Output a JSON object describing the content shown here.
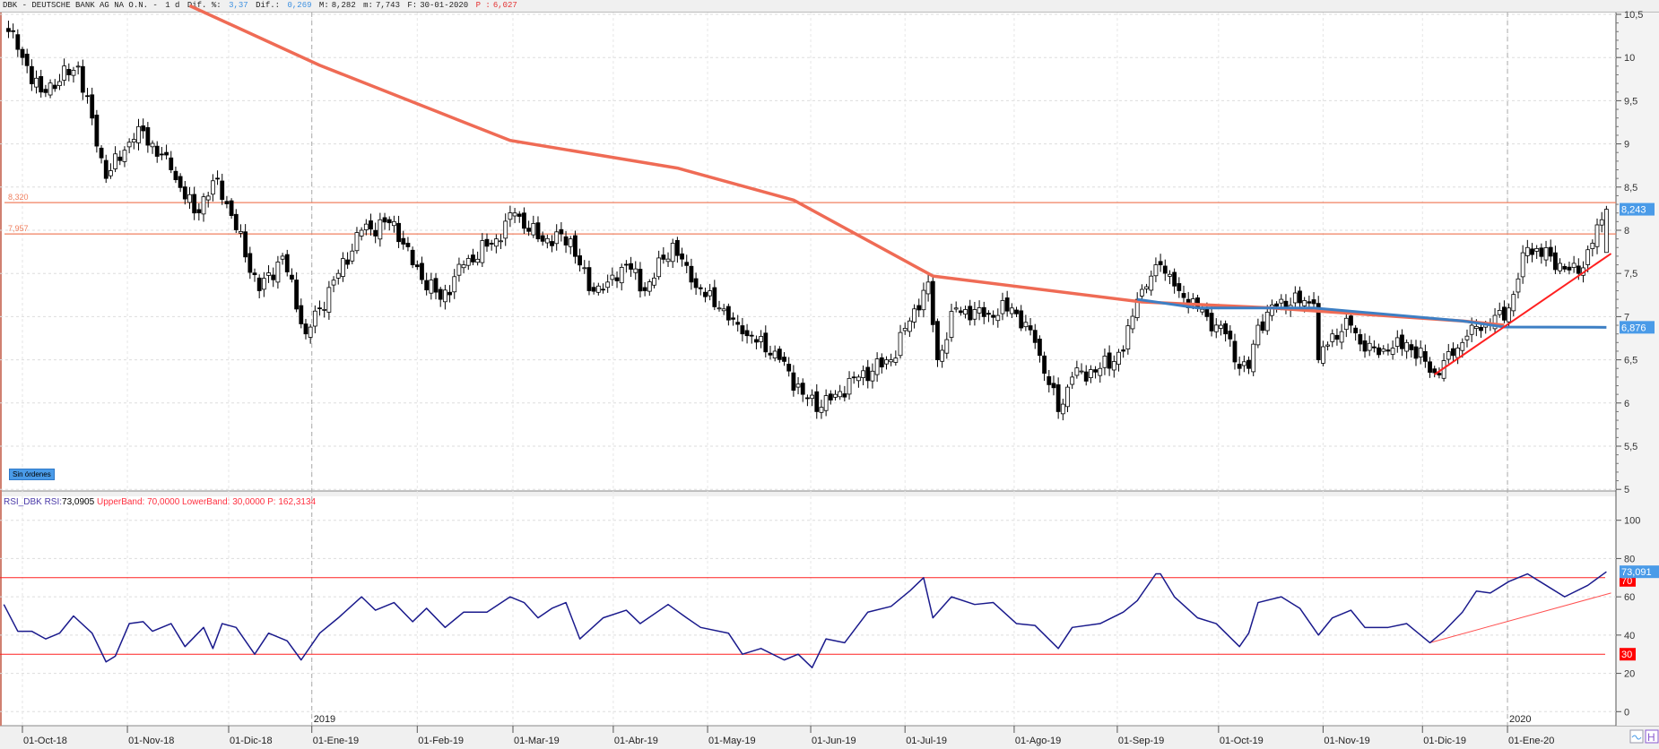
{
  "header": {
    "symbol": "DBK - DEUTSCHE BANK AG NA O.N. -",
    "period": "1 d",
    "dif_pct_label": "Dif. %:",
    "dif_pct": "3,37",
    "dif_label": "Dif.:",
    "dif": "0,269",
    "max_label": "M:",
    "max": "8,282",
    "min_label": "m:",
    "min": "7,743",
    "date_label": "F:",
    "date": "30-01-2020",
    "p_label": "P :",
    "p": "6,027"
  },
  "rsi_header": {
    "name": "RSI_DBK",
    "rsi_label": "RSI:",
    "rsi": "73,0905",
    "upper": "UpperBand: 70,0000",
    "lower": "LowerBand: 30,0000",
    "p": "P: 162,3134"
  },
  "orders_badge": "Sin órdenes",
  "colors": {
    "sma": "#ef6b55",
    "blue_ma": "#3d7fc4",
    "level": "#f08060",
    "trend": "#ff2020",
    "rsi": "#1a1a8c",
    "tag_blue": "#4a9be8",
    "tag_red": "#ff0000"
  },
  "chart_data": [
    {
      "type": "candlestick",
      "title": "DBK - DEUTSCHE BANK AG NA O.N. - 1 d",
      "x_unit": "trading session index (0 = 01-Oct-18)",
      "ylim": [
        5,
        10.5
      ],
      "y_ticks": [
        "10,5",
        "10",
        "9,5",
        "9",
        "8,5",
        "8",
        "7,5",
        "7",
        "6,5",
        "6",
        "5,5",
        "5"
      ],
      "y_tick_values": [
        10.5,
        10,
        9.5,
        9,
        8.5,
        8,
        7.5,
        7,
        6.5,
        6,
        5.5,
        5
      ],
      "x_ticks": [
        {
          "s": 0,
          "label": "01-Oct-18"
        },
        {
          "s": 22.6,
          "label": "01-Nov-18"
        },
        {
          "s": 44.4,
          "label": "01-Dic-18"
        },
        {
          "s": 62.3,
          "label": "01-Ene-19"
        },
        {
          "s": 85,
          "label": "01-Feb-19"
        },
        {
          "s": 105.6,
          "label": "01-Mar-19"
        },
        {
          "s": 127.2,
          "label": "01-Abr-19"
        },
        {
          "s": 147.5,
          "label": "01-May-19"
        },
        {
          "s": 169.7,
          "label": "01-Jun-19"
        },
        {
          "s": 190,
          "label": "01-Jul-19"
        },
        {
          "s": 213.5,
          "label": "01-Ago-19"
        },
        {
          "s": 235.7,
          "label": "01-Sep-19"
        },
        {
          "s": 257.5,
          "label": "01-Oct-19"
        },
        {
          "s": 280,
          "label": "01-Nov-19"
        },
        {
          "s": 301.4,
          "label": "01-Dic-19"
        },
        {
          "s": 319.7,
          "label": "01-Ene-20"
        }
      ],
      "year_marks": [
        {
          "s": 62.3,
          "label": "2019"
        },
        {
          "s": 319.7,
          "label": "2020"
        }
      ],
      "close_anchors": [
        [
          -3,
          10.3
        ],
        [
          4,
          9.6
        ],
        [
          12,
          9.9
        ],
        [
          18,
          8.6
        ],
        [
          25,
          9.2
        ],
        [
          32,
          8.7
        ],
        [
          37,
          8.2
        ],
        [
          42,
          8.6
        ],
        [
          51,
          7.3
        ],
        [
          56,
          7.7
        ],
        [
          61,
          6.8
        ],
        [
          64,
          7.1
        ],
        [
          68,
          7.5
        ],
        [
          73,
          8.0
        ],
        [
          80,
          8.1
        ],
        [
          84,
          7.6
        ],
        [
          90,
          7.2
        ],
        [
          95,
          7.6
        ],
        [
          102,
          7.9
        ],
        [
          106,
          8.2
        ],
        [
          111,
          7.9
        ],
        [
          118,
          7.9
        ],
        [
          122,
          7.3
        ],
        [
          126,
          7.4
        ],
        [
          130,
          7.6
        ],
        [
          134,
          7.3
        ],
        [
          140,
          7.85
        ],
        [
          144,
          7.4
        ],
        [
          150,
          7.1
        ],
        [
          155,
          6.8
        ],
        [
          162,
          6.6
        ],
        [
          168,
          6.1
        ],
        [
          172,
          5.95
        ],
        [
          175,
          6.1
        ],
        [
          180,
          6.3
        ],
        [
          187,
          6.5
        ],
        [
          191,
          6.95
        ],
        [
          195,
          7.4
        ],
        [
          197,
          6.5
        ],
        [
          201,
          7.1
        ],
        [
          207,
          7.0
        ],
        [
          213,
          7.1
        ],
        [
          218,
          6.7
        ],
        [
          223,
          5.9
        ],
        [
          226,
          6.3
        ],
        [
          232,
          6.4
        ],
        [
          237,
          6.6
        ],
        [
          240,
          7.2
        ],
        [
          245,
          7.6
        ],
        [
          249,
          7.3
        ],
        [
          255,
          7.0
        ],
        [
          259,
          6.8
        ],
        [
          262,
          6.4
        ],
        [
          264,
          6.4
        ],
        [
          266,
          6.9
        ],
        [
          271,
          7.2
        ],
        [
          278,
          7.15
        ],
        [
          279,
          6.5
        ],
        [
          282,
          6.8
        ],
        [
          286,
          6.9
        ],
        [
          289,
          6.6
        ],
        [
          294,
          6.6
        ],
        [
          298,
          6.7
        ],
        [
          304,
          6.35
        ],
        [
          308,
          6.55
        ],
        [
          312,
          6.9
        ],
        [
          316,
          6.9
        ],
        [
          320,
          7.1
        ],
        [
          324,
          7.8
        ],
        [
          329,
          7.7
        ],
        [
          332,
          7.55
        ],
        [
          335,
          7.5
        ],
        [
          338,
          7.85
        ],
        [
          341,
          8.243
        ]
      ],
      "last_candle": {
        "s": 341,
        "open": 7.743,
        "high": 8.282,
        "low": 7.743,
        "close": 8.243
      },
      "sma_red": [
        [
          36,
          10.6
        ],
        [
          64,
          9.91
        ],
        [
          105,
          9.04
        ],
        [
          141,
          8.72
        ],
        [
          166,
          8.35
        ],
        [
          196,
          7.47
        ],
        [
          241,
          7.17
        ],
        [
          269,
          7.1
        ],
        [
          310,
          6.95
        ],
        [
          319,
          6.9
        ]
      ],
      "ma_blue": [
        [
          240,
          7.2
        ],
        [
          253,
          7.1
        ],
        [
          278,
          7.1
        ],
        [
          310,
          6.95
        ],
        [
          319,
          6.88
        ],
        [
          341,
          6.876
        ]
      ],
      "levels": [
        {
          "value": 8.32,
          "label": "8,320"
        },
        {
          "value": 7.957,
          "label": "7,957"
        }
      ],
      "trendline": [
        [
          304,
          6.33
        ],
        [
          342,
          7.73
        ]
      ],
      "tags": [
        {
          "value": 8.243,
          "label": "8,243"
        },
        {
          "value": 6.876,
          "label": "6,876"
        }
      ]
    },
    {
      "type": "line",
      "title": "RSI_DBK",
      "ylim": [
        0,
        100
      ],
      "y_ticks": [
        "100",
        "80",
        "60",
        "40",
        "20",
        "0"
      ],
      "y_tick_values": [
        100,
        80,
        60,
        40,
        20,
        0
      ],
      "bands": [
        70,
        30
      ],
      "series": [
        {
          "name": "RSI",
          "points": [
            [
              -4,
              56
            ],
            [
              -1,
              42
            ],
            [
              2,
              42
            ],
            [
              5,
              38
            ],
            [
              8,
              41
            ],
            [
              11,
              50
            ],
            [
              15,
              41
            ],
            [
              18,
              26
            ],
            [
              20,
              29
            ],
            [
              23,
              46
            ],
            [
              26,
              47
            ],
            [
              28,
              42
            ],
            [
              32,
              46
            ],
            [
              35,
              34
            ],
            [
              39,
              44
            ],
            [
              41,
              33
            ],
            [
              43,
              46
            ],
            [
              46,
              44
            ],
            [
              50,
              30
            ],
            [
              53,
              41
            ],
            [
              57,
              37
            ],
            [
              60,
              27
            ],
            [
              64,
              41
            ],
            [
              68,
              49
            ],
            [
              73,
              60
            ],
            [
              76,
              53
            ],
            [
              80,
              57
            ],
            [
              84,
              47
            ],
            [
              87,
              54
            ],
            [
              91,
              44
            ],
            [
              95,
              52
            ],
            [
              100,
              52
            ],
            [
              105,
              60
            ],
            [
              108,
              57
            ],
            [
              111,
              49
            ],
            [
              114,
              54
            ],
            [
              117,
              57
            ],
            [
              120,
              38
            ],
            [
              125,
              49
            ],
            [
              130,
              53
            ],
            [
              133,
              46
            ],
            [
              139,
              56
            ],
            [
              143,
              49
            ],
            [
              146,
              44
            ],
            [
              152,
              41
            ],
            [
              155,
              30
            ],
            [
              159,
              33
            ],
            [
              164,
              27
            ],
            [
              167,
              30
            ],
            [
              170,
              23
            ],
            [
              173,
              38
            ],
            [
              177,
              36
            ],
            [
              182,
              52
            ],
            [
              187,
              55
            ],
            [
              191,
              63
            ],
            [
              194,
              70
            ],
            [
              196,
              49
            ],
            [
              200,
              60
            ],
            [
              205,
              56
            ],
            [
              209,
              57
            ],
            [
              214,
              46
            ],
            [
              218,
              45
            ],
            [
              223,
              33
            ],
            [
              226,
              44
            ],
            [
              232,
              46
            ],
            [
              237,
              52
            ],
            [
              240,
              58
            ],
            [
              244,
              72
            ],
            [
              245,
              72
            ],
            [
              248,
              60
            ],
            [
              253,
              49
            ],
            [
              257,
              46
            ],
            [
              262,
              34
            ],
            [
              264,
              41
            ],
            [
              266,
              57
            ],
            [
              271,
              60
            ],
            [
              275,
              54
            ],
            [
              279,
              40
            ],
            [
              282,
              49
            ],
            [
              286,
              53
            ],
            [
              289,
              44
            ],
            [
              294,
              44
            ],
            [
              298,
              46
            ],
            [
              303,
              36
            ],
            [
              306,
              42
            ],
            [
              310,
              52
            ],
            [
              313,
              63
            ],
            [
              316,
              62
            ],
            [
              320,
              68
            ],
            [
              324,
              72
            ],
            [
              328,
              66
            ],
            [
              332,
              60
            ],
            [
              337,
              66
            ],
            [
              341,
              73.09
            ]
          ]
        }
      ],
      "trendline": [
        [
          303,
          36
        ],
        [
          342,
          62
        ]
      ],
      "tags": [
        {
          "value": 73.091,
          "label": "73,091",
          "color": "blue"
        },
        {
          "value": 70,
          "label": "70",
          "color": "red"
        },
        {
          "value": 30,
          "label": "30",
          "color": "red"
        }
      ]
    }
  ]
}
